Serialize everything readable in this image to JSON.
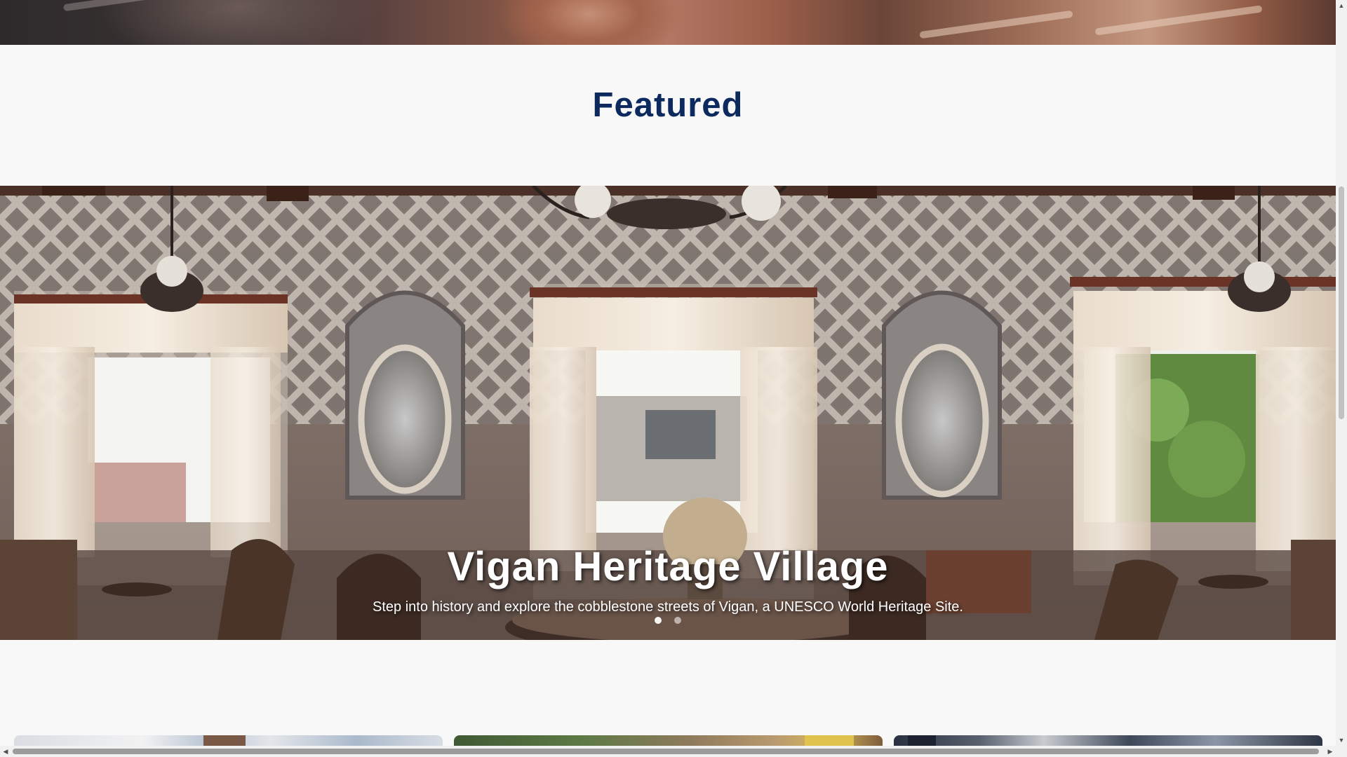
{
  "featured": {
    "title": "Featured"
  },
  "carousel": {
    "title": "Vigan Heritage Village",
    "subtitle": "Step into history and explore the cobblestone streets of Vigan, a UNESCO World Heritage Site.",
    "active_index": 0,
    "slide_count": 2
  },
  "cards": [
    {
      "image": "sky-and-bell-tower-photo"
    },
    {
      "image": "tree-and-colorful-buildings-photo"
    },
    {
      "image": "street-market-photo"
    }
  ],
  "colors": {
    "title": "#0d2a5e",
    "page_bg": "#f8f8f8"
  },
  "icons": {
    "scroll_up": "▲",
    "scroll_down": "▼",
    "scroll_left": "◀",
    "scroll_right": "▶"
  }
}
